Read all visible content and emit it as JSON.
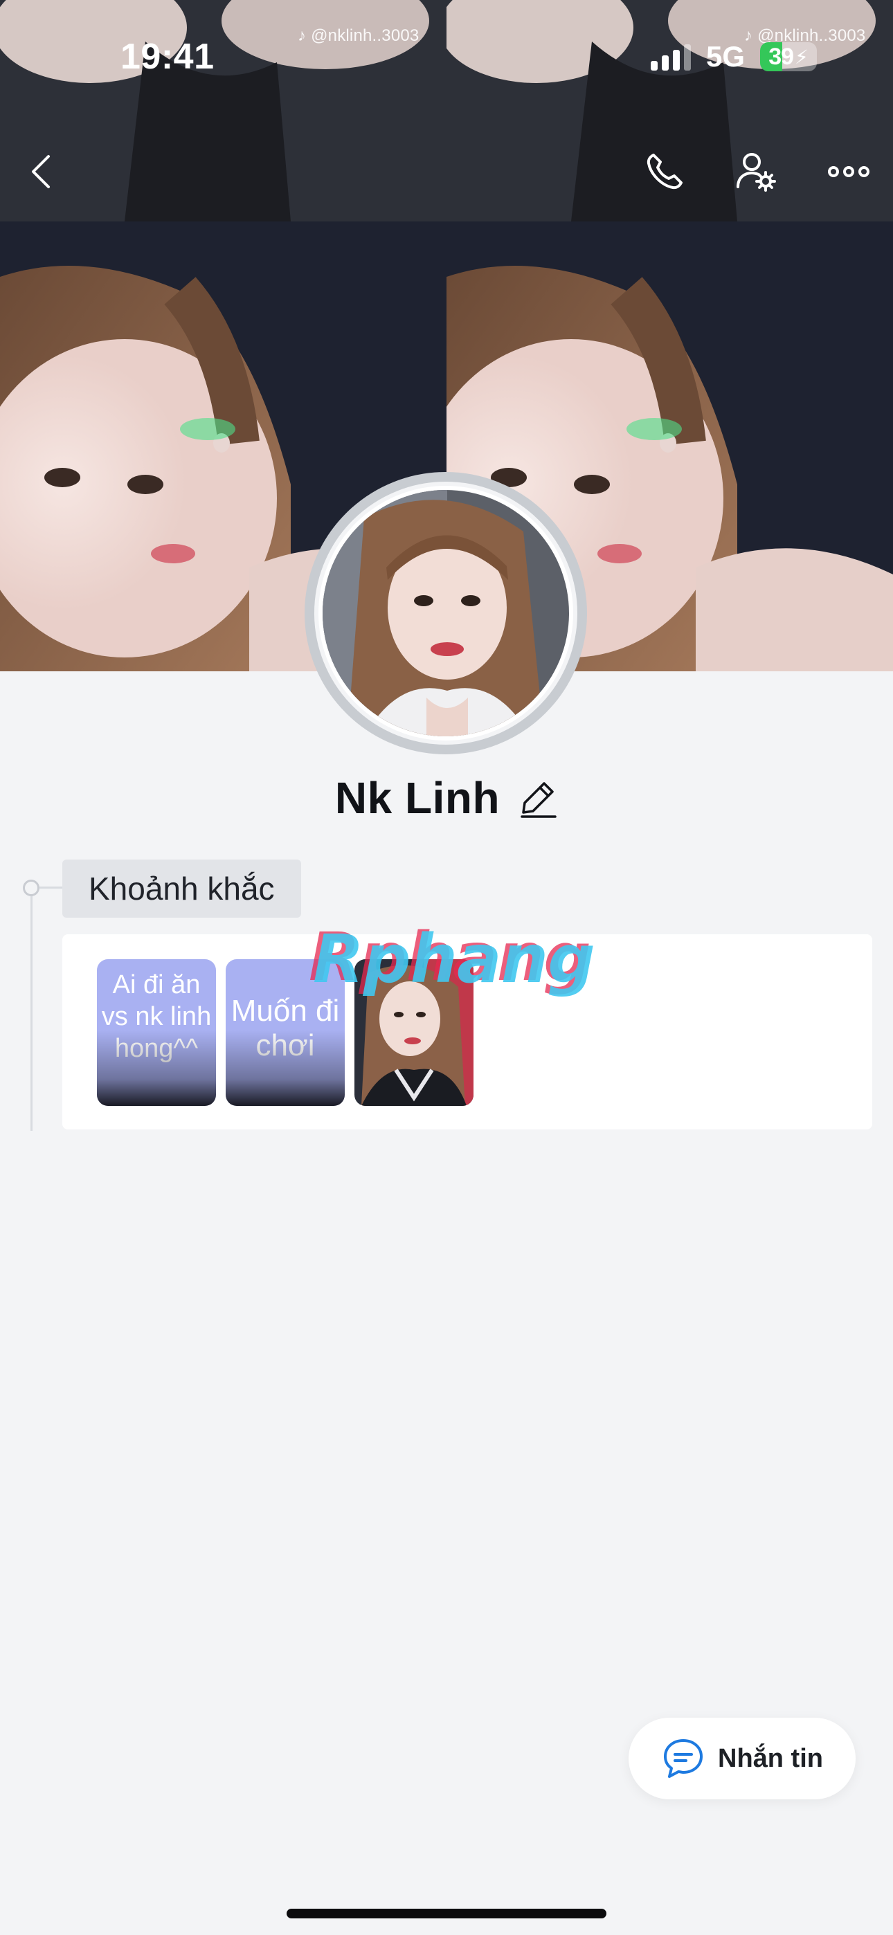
{
  "status_bar": {
    "time": "19:41",
    "network": "5G",
    "battery": "39",
    "battery_level_percent": 39,
    "signal_bars_active": 3
  },
  "cover": {
    "watermark_handle_left": "@nklinh..3003",
    "watermark_handle_right": "@nklinh..3003"
  },
  "nav": {
    "back_icon": "chevron-left-icon",
    "call_icon": "phone-icon",
    "settings_icon": "user-gear-icon",
    "more_icon": "more-dots-icon"
  },
  "profile": {
    "name": "Nk Linh",
    "edit_icon": "pencil-icon"
  },
  "moments": {
    "label": "Khoảnh khắc",
    "items": [
      {
        "type": "text",
        "text": "Ai đi ăn vs nk linh hong^^"
      },
      {
        "type": "text",
        "text": "Muốn đi chơi"
      },
      {
        "type": "photo",
        "text": ""
      }
    ]
  },
  "watermark": "Rphang",
  "message_button": {
    "label": "Nhắn tin",
    "icon": "chat-bubble-icon"
  },
  "colors": {
    "background": "#f3f4f6",
    "story_bg": "#a9b1f2",
    "accent": "#1e7ae0"
  }
}
